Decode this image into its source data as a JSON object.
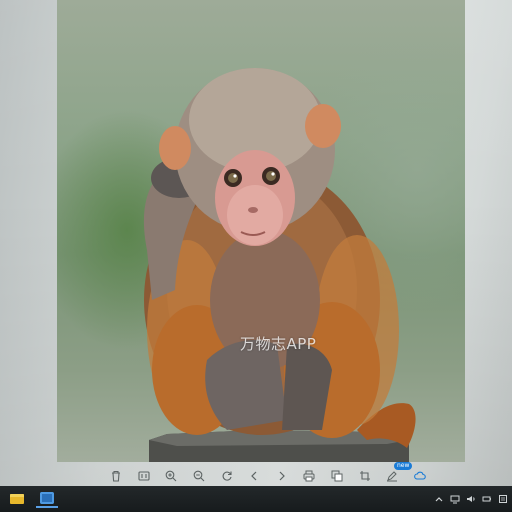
{
  "viewer": {
    "watermark": "万物志APP",
    "toolbar": [
      {
        "name": "delete-icon",
        "glyph": "trash"
      },
      {
        "name": "actual-size-icon",
        "glyph": "1:1"
      },
      {
        "name": "zoom-in-icon",
        "glyph": "zoom-in"
      },
      {
        "name": "zoom-out-icon",
        "glyph": "zoom-out"
      },
      {
        "name": "rotate-icon",
        "glyph": "rotate"
      },
      {
        "name": "previous-icon",
        "glyph": "chevron-left"
      },
      {
        "name": "next-icon",
        "glyph": "chevron-right"
      },
      {
        "name": "print-icon",
        "glyph": "printer"
      },
      {
        "name": "gallery-icon",
        "glyph": "gallery"
      },
      {
        "name": "crop-icon",
        "glyph": "crop"
      },
      {
        "name": "edit-icon",
        "glyph": "pencil"
      },
      {
        "name": "share-icon",
        "glyph": "cloud"
      }
    ],
    "badge": "new"
  },
  "taskbar": {
    "apps": [
      {
        "name": "file-explorer-icon",
        "color": "#e8b82c"
      },
      {
        "name": "photo-app-icon",
        "color": "#2a6fb8"
      }
    ],
    "tray": [
      "chevron-up-icon",
      "network-icon",
      "speaker-icon",
      "battery-icon",
      "notification-icon"
    ]
  },
  "colors": {
    "accent": "#1a7bd6",
    "taskbar": "#1d2224",
    "monitor_bezel": "#d8dcdb"
  }
}
